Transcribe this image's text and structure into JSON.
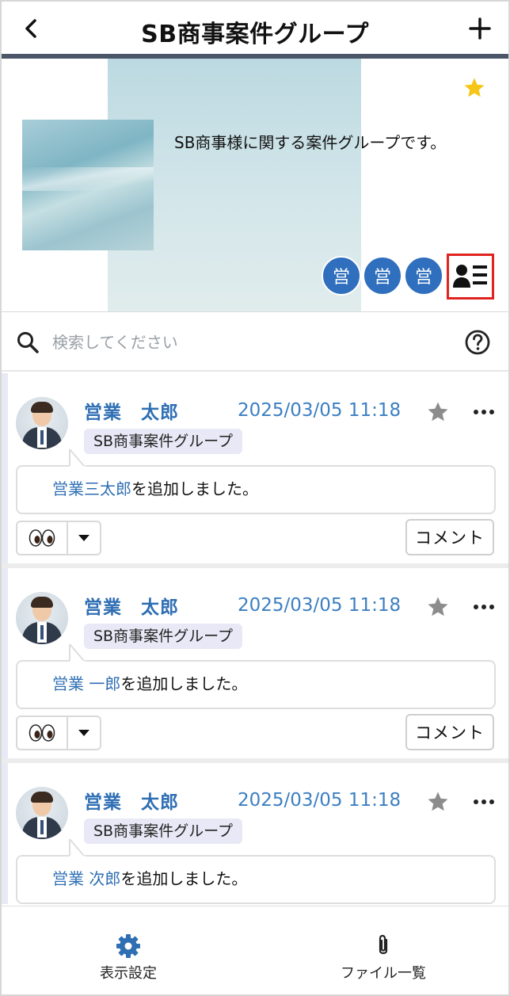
{
  "header": {
    "title": "SB商事案件グループ"
  },
  "group": {
    "description": "SB商事様に関する案件グループです。",
    "favorite": true,
    "members": [
      "営",
      "営",
      "営"
    ]
  },
  "search": {
    "placeholder": "検索してください"
  },
  "posts": [
    {
      "author": "営業　太郎",
      "timestamp": "2025/03/05 11:18",
      "group_tag": "SB商事案件グループ",
      "message_link": "営業三太郎",
      "message_text": "を追加しました。",
      "reaction": "👀",
      "comment_label": "コメント"
    },
    {
      "author": "営業　太郎",
      "timestamp": "2025/03/05 11:18",
      "group_tag": "SB商事案件グループ",
      "message_link": "営業 一郎",
      "message_text": "を追加しました。",
      "reaction": "👀",
      "comment_label": "コメント"
    },
    {
      "author": "営業　太郎",
      "timestamp": "2025/03/05 11:18",
      "group_tag": "SB商事案件グループ",
      "message_link": "営業 次郎",
      "message_text": "を追加しました。"
    }
  ],
  "bottom_nav": {
    "display_settings": "表示設定",
    "file_list": "ファイル一覧"
  },
  "colors": {
    "accent": "#2e6eb3",
    "header_bar": "#4b5668",
    "favorite_star": "#f5c518",
    "highlight_box": "#e0231f"
  }
}
